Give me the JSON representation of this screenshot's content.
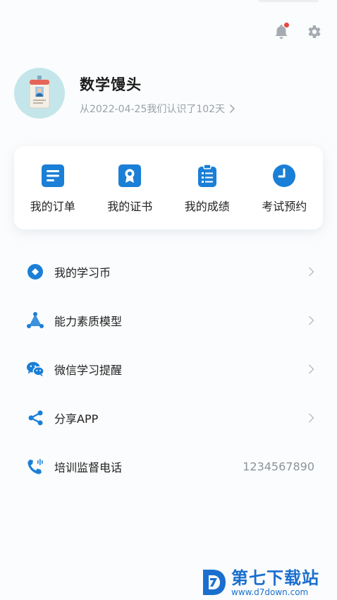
{
  "header": {
    "notification_icon": "bell-icon",
    "settings_icon": "gear-icon",
    "colors": {
      "icon_gray": "#a6abb2",
      "badge_red": "#e8473d"
    }
  },
  "profile": {
    "avatar_icon": "id-badge-icon",
    "username": "数学馒头",
    "since_text": "从2022-04-25我们认识了102天"
  },
  "quick_actions": [
    {
      "label": "我的订单",
      "icon": "order-list-icon"
    },
    {
      "label": "我的证书",
      "icon": "certificate-icon"
    },
    {
      "label": "我的成绩",
      "icon": "score-clipboard-icon"
    },
    {
      "label": "考试预约",
      "icon": "clock-icon"
    }
  ],
  "menu": [
    {
      "label": "我的学习币",
      "icon": "coin-icon"
    },
    {
      "label": "能力素质模型",
      "icon": "model-triangle-icon"
    },
    {
      "label": "微信学习提醒",
      "icon": "wechat-icon"
    },
    {
      "label": "分享APP",
      "icon": "share-icon"
    },
    {
      "label": "培训监督电话",
      "icon": "phone-icon",
      "value": "1234567890"
    }
  ],
  "watermark": {
    "brand": "第七下载站",
    "url": "www.d7down.com"
  },
  "colors": {
    "accent": "#1a7fd6",
    "text": "#222222",
    "muted": "#9aa0a8"
  }
}
